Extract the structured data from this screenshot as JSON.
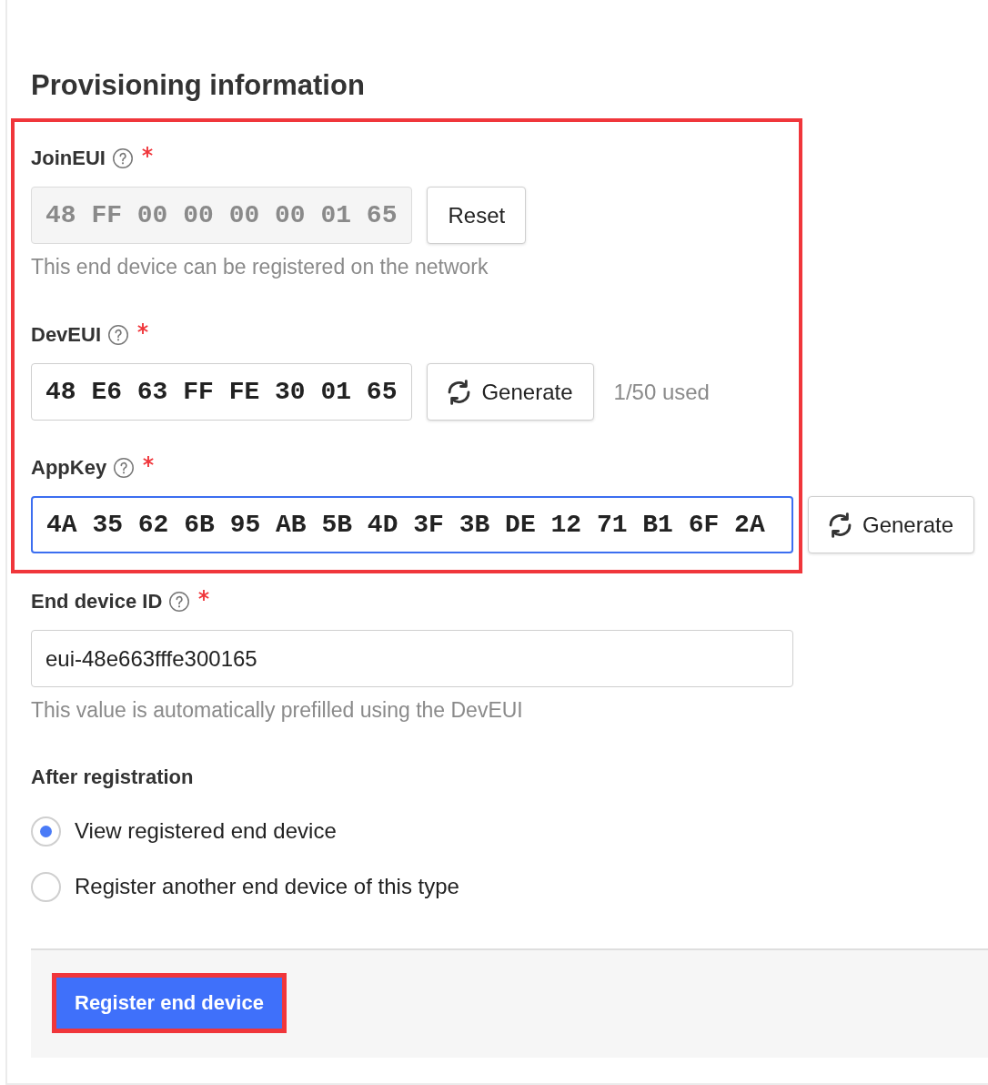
{
  "heading": "Provisioning information",
  "key_fields": {
    "highlighted": true,
    "fields": [
      {
        "kind": "eui",
        "label": "JoinEUI",
        "required": true,
        "value": "48 FF 00 00 00 00 01 65",
        "disabled": true,
        "focused": false,
        "action": {
          "kind": "reset",
          "label": "Reset"
        },
        "hint": "This end device can be registered on the network"
      },
      {
        "kind": "eui",
        "label": "DevEUI",
        "required": true,
        "value": "48 E6 63 FF FE 30 01 65",
        "disabled": false,
        "focused": false,
        "action": {
          "kind": "generate",
          "label": "Generate"
        },
        "usage": "1/50 used"
      },
      {
        "kind": "key",
        "label": "AppKey",
        "required": true,
        "value": "4A 35 62 6B 95 AB 5B 4D 3F 3B DE 12 71 B1 6F 2A",
        "disabled": false,
        "focused": true,
        "action": {
          "kind": "generate",
          "label": "Generate"
        }
      }
    ]
  },
  "device_id": {
    "label": "End device ID",
    "required": true,
    "value": "eui-48e663fffe300165",
    "focused": false,
    "hint": "This value is automatically prefilled using the DevEUI"
  },
  "after_registration": {
    "title": "After registration",
    "options": [
      {
        "label": "View registered end device",
        "selected": true
      },
      {
        "label": "Register another end device of this type",
        "selected": false
      }
    ]
  },
  "submit": {
    "label": "Register end device",
    "highlighted": true
  }
}
